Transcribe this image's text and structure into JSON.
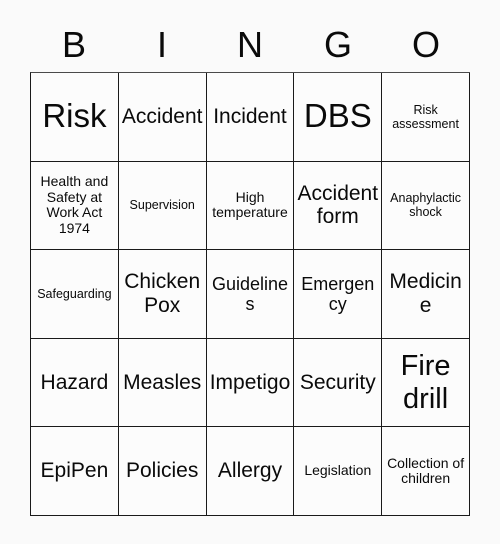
{
  "header": {
    "letters": [
      "B",
      "I",
      "N",
      "G",
      "O"
    ]
  },
  "grid": {
    "columns": 5,
    "rows": 5,
    "border_color": "#1a1a1a",
    "cell_background": "#fcfcfc",
    "page_background": "#fafafa",
    "text_color": "#0a0a0a",
    "cells": [
      {
        "label": "Risk",
        "size": "xl"
      },
      {
        "label": "Accident",
        "size": "md"
      },
      {
        "label": "Incident",
        "size": "md"
      },
      {
        "label": "DBS",
        "size": "xl"
      },
      {
        "label": "Risk assessment",
        "size": "xxs"
      },
      {
        "label": "Health and Safety at Work Act 1974",
        "size": "xs"
      },
      {
        "label": "Supervision",
        "size": "xxs"
      },
      {
        "label": "High temperature",
        "size": "xs"
      },
      {
        "label": "Accident form",
        "size": "md"
      },
      {
        "label": "Anaphylactic shock",
        "size": "xxs"
      },
      {
        "label": "Safeguarding",
        "size": "xxs"
      },
      {
        "label": "Chicken Pox",
        "size": "md"
      },
      {
        "label": "Guidelines",
        "size": "sm"
      },
      {
        "label": "Emergency",
        "size": "sm"
      },
      {
        "label": "Medicine",
        "size": "md"
      },
      {
        "label": "Hazard",
        "size": "md"
      },
      {
        "label": "Measles",
        "size": "md"
      },
      {
        "label": "Impetigo",
        "size": "md"
      },
      {
        "label": "Security",
        "size": "md"
      },
      {
        "label": "Fire drill",
        "size": "lg"
      },
      {
        "label": "EpiPen",
        "size": "md"
      },
      {
        "label": "Policies",
        "size": "md"
      },
      {
        "label": "Allergy",
        "size": "md"
      },
      {
        "label": "Legislation",
        "size": "xs"
      },
      {
        "label": "Collection of children",
        "size": "xs"
      }
    ]
  }
}
